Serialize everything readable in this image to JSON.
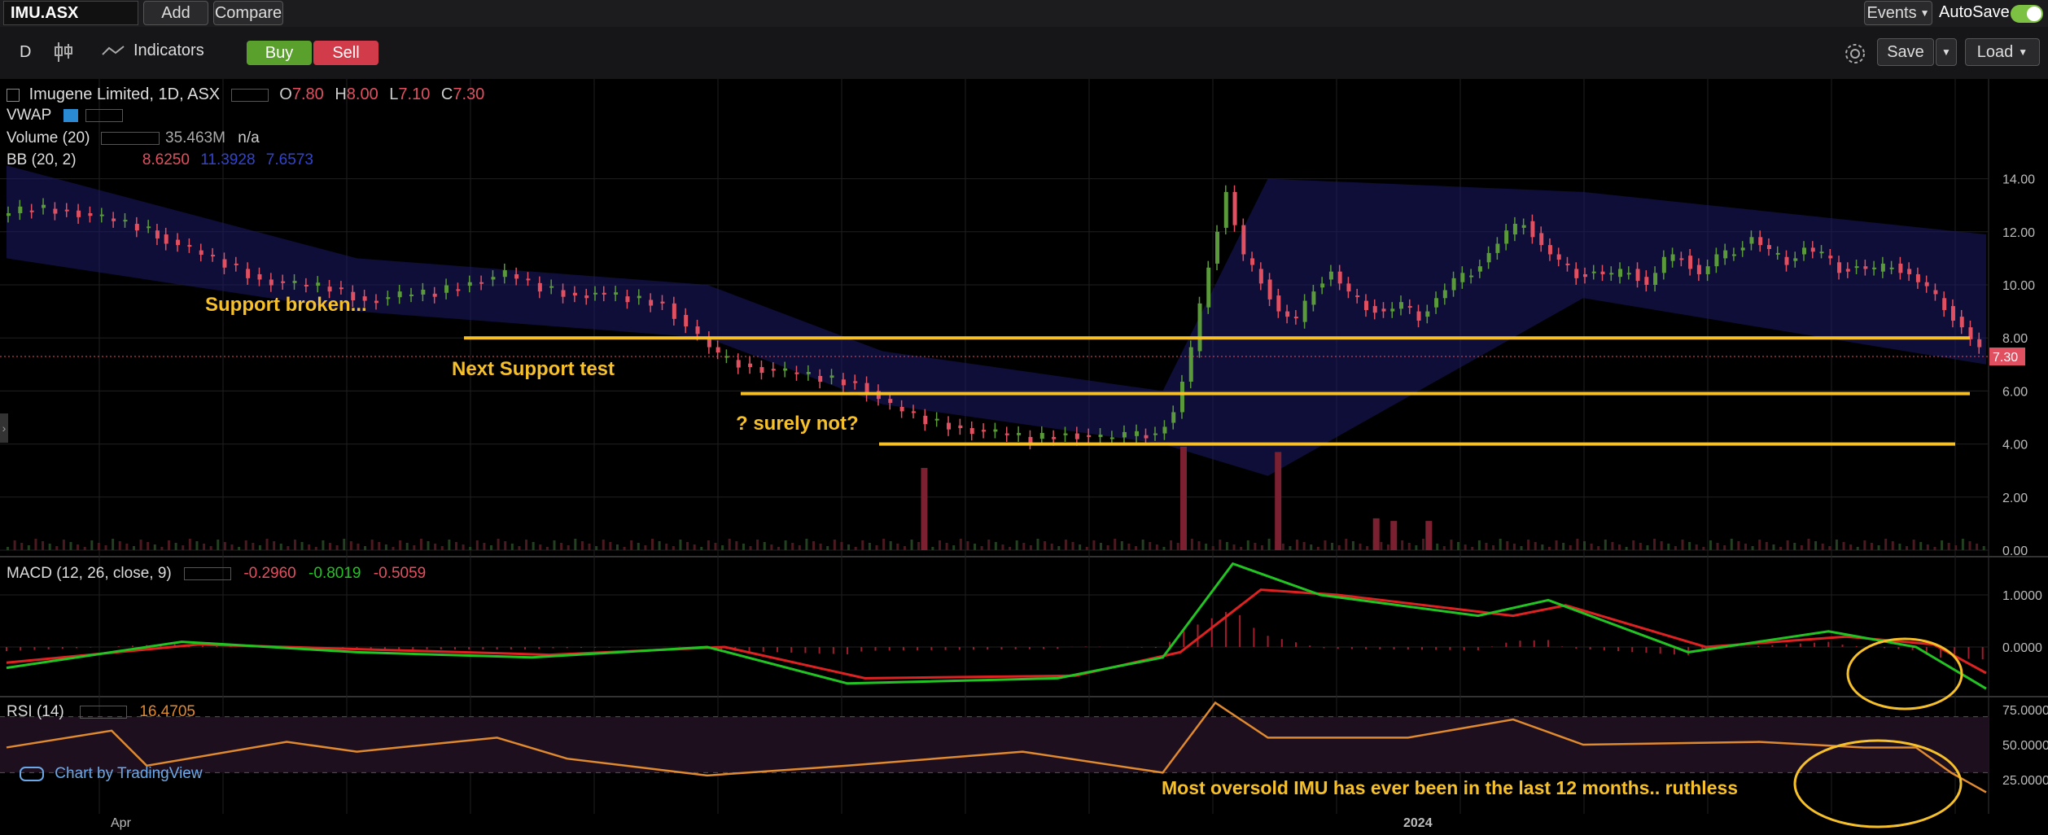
{
  "toolbar": {
    "symbol": "IMU.ASX",
    "add": "Add",
    "compare": "Compare",
    "events": "Events",
    "autosave": "AutoSave",
    "interval": "D",
    "indicators": "Indicators",
    "buy": "Buy",
    "sell": "Sell",
    "save": "Save",
    "load": "Load"
  },
  "legend": {
    "title": "Imugene Limited, 1D, ASX",
    "o_label": "O",
    "o": "7.80",
    "h_label": "H",
    "h": "8.00",
    "l_label": "L",
    "l": "7.10",
    "c_label": "C",
    "c": "7.30",
    "vwap": "VWAP",
    "volume": "Volume (20)",
    "volume_val": "35.463M",
    "volume_na": "n/a",
    "bb": "BB (20, 2)",
    "bb_v1": "8.6250",
    "bb_v2": "11.3928",
    "bb_v3": "7.6573",
    "macd": "MACD (12, 26, close, 9)",
    "macd_v1": "-0.2960",
    "macd_v2": "-0.8019",
    "macd_v3": "-0.5059",
    "rsi": "RSI (14)",
    "rsi_v": "16.4705"
  },
  "annotations": {
    "support_broken": "Support broken...",
    "next_support": "Next Support test",
    "surely_not": "? surely not?",
    "oversold": "Most oversold IMU has ever been in the last 12 months.. ruthless"
  },
  "attribution": "Chart by TradingView",
  "colors": {
    "up": "#5a9a3a",
    "down": "#e05060",
    "annotation": "#f5c02a",
    "macd": "#22c322",
    "signal": "#dd2222",
    "rsi": "#e08a30",
    "bb": "#1a1a66"
  },
  "chart_data": [
    {
      "type": "candlestick",
      "title": "Imugene Limited, 1D, ASX",
      "x_labels": [
        "Apr",
        "2024"
      ],
      "y_ticks": [
        "0.00",
        "2.00",
        "4.00",
        "6.00",
        "8.00",
        "10.00",
        "12.00",
        "14.00"
      ],
      "ylim": [
        0,
        15
      ],
      "last_price": "7.30",
      "close_path": [
        [
          0,
          12.6
        ],
        [
          10,
          12.9
        ],
        [
          20,
          12.8
        ],
        [
          30,
          12.5
        ],
        [
          40,
          12.2
        ],
        [
          45,
          11.9
        ],
        [
          55,
          11.3
        ],
        [
          65,
          10.8
        ],
        [
          75,
          10.2
        ],
        [
          85,
          10.0
        ],
        [
          95,
          9.9
        ],
        [
          105,
          9.4
        ],
        [
          115,
          9.6
        ],
        [
          125,
          9.7
        ],
        [
          135,
          10.1
        ],
        [
          145,
          10.4
        ],
        [
          155,
          9.9
        ],
        [
          165,
          9.6
        ],
        [
          170,
          9.7
        ],
        [
          180,
          9.5
        ],
        [
          190,
          9.3
        ],
        [
          200,
          8.0
        ],
        [
          205,
          7.3
        ],
        [
          215,
          6.9
        ],
        [
          225,
          6.7
        ],
        [
          235,
          6.5
        ],
        [
          245,
          6.3
        ],
        [
          255,
          5.4
        ],
        [
          265,
          4.9
        ],
        [
          275,
          4.6
        ],
        [
          285,
          4.4
        ],
        [
          295,
          4.2
        ],
        [
          305,
          4.4
        ],
        [
          315,
          4.2
        ],
        [
          322,
          4.3
        ],
        [
          330,
          4.4
        ],
        [
          335,
          5.2
        ],
        [
          340,
          7.5
        ],
        [
          345,
          10.8
        ],
        [
          350,
          13.5
        ],
        [
          355,
          11.0
        ],
        [
          360,
          10.2
        ],
        [
          365,
          9.0
        ],
        [
          370,
          8.6
        ],
        [
          375,
          9.9
        ],
        [
          380,
          10.5
        ],
        [
          385,
          9.6
        ],
        [
          390,
          9.2
        ],
        [
          395,
          9.0
        ],
        [
          400,
          9.2
        ],
        [
          405,
          8.8
        ],
        [
          410,
          9.5
        ],
        [
          415,
          10.1
        ],
        [
          420,
          10.5
        ],
        [
          425,
          11.2
        ],
        [
          430,
          11.9
        ],
        [
          435,
          12.4
        ],
        [
          440,
          11.5
        ],
        [
          445,
          10.8
        ],
        [
          450,
          10.4
        ],
        [
          455,
          10.5
        ],
        [
          460,
          10.3
        ],
        [
          465,
          10.6
        ],
        [
          470,
          10.0
        ],
        [
          475,
          10.9
        ],
        [
          480,
          11.1
        ],
        [
          485,
          10.4
        ],
        [
          490,
          11.0
        ],
        [
          495,
          11.3
        ],
        [
          500,
          11.8
        ],
        [
          505,
          11.2
        ],
        [
          510,
          10.9
        ],
        [
          515,
          11.4
        ],
        [
          520,
          11.1
        ],
        [
          525,
          10.6
        ],
        [
          530,
          10.7
        ],
        [
          535,
          10.5
        ],
        [
          540,
          10.8
        ],
        [
          545,
          10.4
        ],
        [
          550,
          9.8
        ],
        [
          555,
          9.2
        ],
        [
          560,
          8.4
        ],
        [
          565,
          7.5
        ]
      ],
      "volume_spikes": [
        [
          261,
          3.1
        ],
        [
          335,
          3.9
        ],
        [
          362,
          3.7
        ],
        [
          390,
          1.2
        ],
        [
          395,
          1.1
        ],
        [
          405,
          1.1
        ]
      ],
      "bollinger": {
        "upper_path": [
          [
            0,
            14.5
          ],
          [
            100,
            11.0
          ],
          [
            200,
            10.0
          ],
          [
            250,
            7.5
          ],
          [
            330,
            6.0
          ],
          [
            360,
            14.0
          ],
          [
            450,
            13.5
          ],
          [
            565,
            11.9
          ]
        ],
        "lower_path": [
          [
            0,
            11.0
          ],
          [
            100,
            9.0
          ],
          [
            200,
            8.0
          ],
          [
            250,
            5.5
          ],
          [
            330,
            4.0
          ],
          [
            360,
            2.8
          ],
          [
            450,
            9.5
          ],
          [
            565,
            7.0
          ]
        ]
      },
      "support_lines": [
        8.0,
        5.9,
        4.0
      ]
    },
    {
      "type": "line",
      "title": "MACD (12, 26, close, 9)",
      "y_ticks": [
        "1.0000",
        "0.0000"
      ],
      "series": [
        {
          "name": "MACD",
          "path": [
            [
              0,
              -0.4
            ],
            [
              50,
              0.1
            ],
            [
              100,
              -0.1
            ],
            [
              150,
              -0.2
            ],
            [
              200,
              0.0
            ],
            [
              240,
              -0.7
            ],
            [
              300,
              -0.6
            ],
            [
              330,
              -0.2
            ],
            [
              350,
              1.6
            ],
            [
              375,
              1.0
            ],
            [
              420,
              0.6
            ],
            [
              440,
              0.9
            ],
            [
              480,
              -0.1
            ],
            [
              520,
              0.3
            ],
            [
              545,
              0.0
            ],
            [
              565,
              -0.8
            ]
          ]
        },
        {
          "name": "Signal",
          "path": [
            [
              0,
              -0.3
            ],
            [
              55,
              0.05
            ],
            [
              105,
              -0.05
            ],
            [
              155,
              -0.15
            ],
            [
              205,
              0.0
            ],
            [
              245,
              -0.6
            ],
            [
              305,
              -0.55
            ],
            [
              335,
              -0.1
            ],
            [
              358,
              1.1
            ],
            [
              380,
              1.0
            ],
            [
              430,
              0.6
            ],
            [
              445,
              0.8
            ],
            [
              485,
              0.0
            ],
            [
              525,
              0.2
            ],
            [
              550,
              0.05
            ],
            [
              565,
              -0.5
            ]
          ]
        }
      ]
    },
    {
      "type": "line",
      "title": "RSI (14)",
      "y_ticks": [
        "75.0000",
        "50.0000",
        "25.0000"
      ],
      "series": [
        {
          "name": "RSI",
          "path": [
            [
              0,
              48
            ],
            [
              30,
              60
            ],
            [
              40,
              35
            ],
            [
              80,
              52
            ],
            [
              100,
              45
            ],
            [
              140,
              55
            ],
            [
              160,
              40
            ],
            [
              200,
              28
            ],
            [
              240,
              35
            ],
            [
              290,
              45
            ],
            [
              330,
              30
            ],
            [
              345,
              80
            ],
            [
              360,
              55
            ],
            [
              400,
              55
            ],
            [
              430,
              68
            ],
            [
              450,
              50
            ],
            [
              500,
              52
            ],
            [
              530,
              48
            ],
            [
              545,
              48
            ],
            [
              555,
              30
            ],
            [
              565,
              16
            ]
          ]
        }
      ]
    }
  ]
}
